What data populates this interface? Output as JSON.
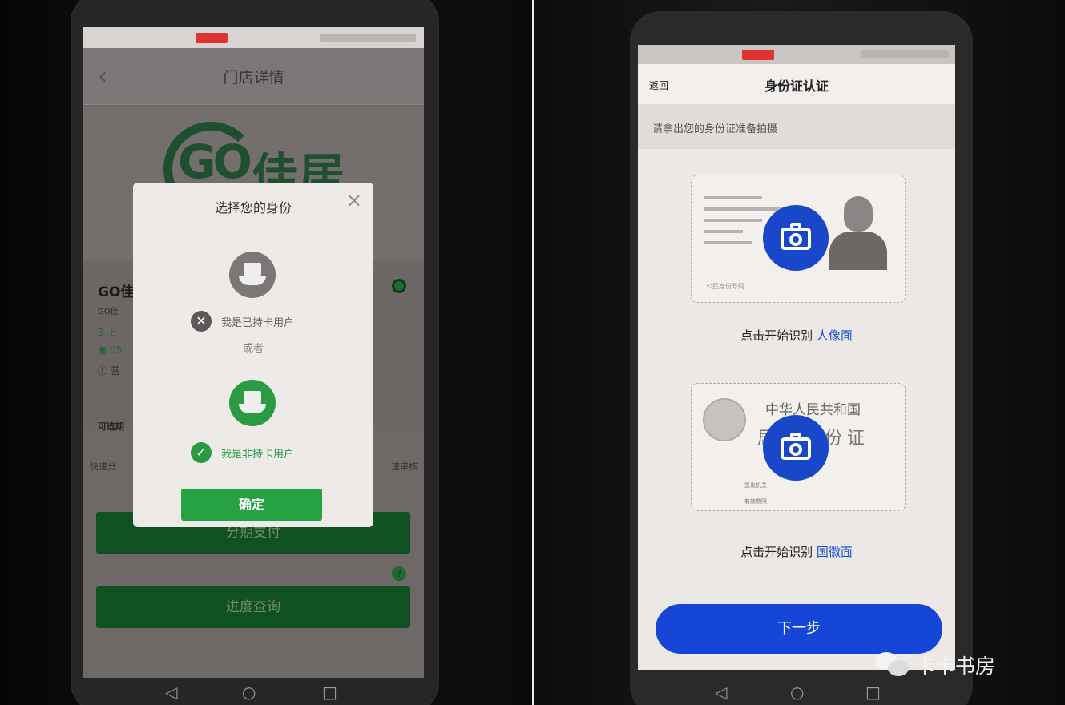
{
  "left": {
    "nav": {
      "back_icon": "‹",
      "title": "门店详情"
    },
    "logo": {
      "go": "GO",
      "brand": "佳居"
    },
    "store": {
      "name": "GO佳",
      "sub": "GO佳",
      "row1": "9 上",
      "row2": "▣ 05",
      "row3": "ⓘ 营"
    },
    "section_label": "可选期",
    "row_left": "快速分",
    "row_right": "速审核",
    "buttons": {
      "pay": "分期支付",
      "progress": "进度查询"
    },
    "modal": {
      "title": "选择您的身份",
      "close_icon": "×",
      "option_card_user": "我是已持卡用户",
      "or": "或者",
      "option_non_card_user": "我是非持卡用户",
      "confirm": "确定"
    }
  },
  "right": {
    "nav": {
      "back": "返回",
      "title": "身份证认证"
    },
    "hint": "请拿出您的身份证准备拍摄",
    "front_caption": {
      "prefix": "点击开始识别",
      "highlight": "人像面"
    },
    "back_caption": {
      "prefix": "点击开始识别",
      "highlight": "国徽面"
    },
    "back_card": {
      "line1": "中华人民共和国",
      "line2": "居民身份证",
      "issuer": "签发机关",
      "valid": "有效期限"
    },
    "front_card": {
      "number_label": "公民身份号码"
    },
    "next": "下一步"
  },
  "softkeys": {
    "back": "◁",
    "home": "○",
    "recent": "□"
  },
  "watermark": "卡卡书房",
  "colors": {
    "green": "#26a243",
    "blue": "#1646d8",
    "dark_green": "#0f5120"
  }
}
